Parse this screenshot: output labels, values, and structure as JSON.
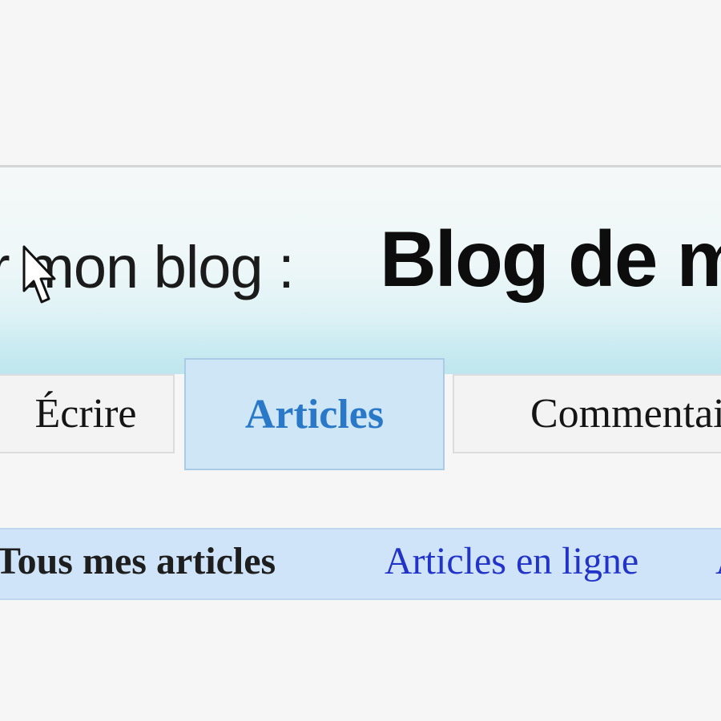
{
  "banner": {
    "prefix": "r mon blog :",
    "title": "Blog de m"
  },
  "tabs": {
    "ecrire": "Écrire",
    "articles": "Articles",
    "commentaires": "Commentai"
  },
  "subnav": {
    "all": "Tous mes articles",
    "online": "Articles en ligne",
    "next": "A"
  },
  "colors": {
    "active_tab_bg": "#cfe6f7",
    "active_tab_text": "#2a79c8",
    "link": "#2233c9",
    "subnav_bg": "#cfe4f8"
  },
  "icons": {
    "cursor": "mouse-pointer-icon"
  }
}
